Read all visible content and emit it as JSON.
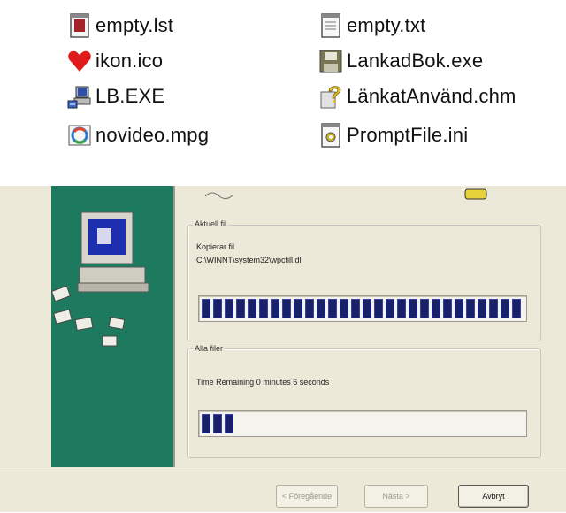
{
  "files": [
    {
      "name": "empty.lst",
      "icon": "document-red-icon"
    },
    {
      "name": "empty.txt",
      "icon": "text-file-icon"
    },
    {
      "name": "ikon.ico",
      "icon": "heart-icon"
    },
    {
      "name": "LankadBok.exe",
      "icon": "floppy-icon"
    },
    {
      "name": "LB.EXE",
      "icon": "setup-program-icon"
    },
    {
      "name": "LänkatAnvänd.chm",
      "icon": "help-file-icon"
    },
    {
      "name": "novideo.mpg",
      "icon": "media-file-icon"
    },
    {
      "name": "PromptFile.ini",
      "icon": "config-file-icon"
    }
  ],
  "installer": {
    "current_file_legend": "Aktuell fil",
    "copying_label": "Kopierar fil",
    "copying_path": "C:\\WINNT\\system32\\wpcfill.dll",
    "all_files_legend": "Alla filer",
    "time_remaining": "Time Remaining 0 minutes 6 seconds",
    "current_progress": 1.0,
    "total_progress": 0.12,
    "buttons": {
      "back": "< Föregående",
      "next": "Nästa >",
      "cancel": "Avbryt"
    }
  },
  "colors": {
    "sidebar": "#1e7a5e",
    "progress_fill": "#18206a",
    "window": "#ece9d8"
  }
}
